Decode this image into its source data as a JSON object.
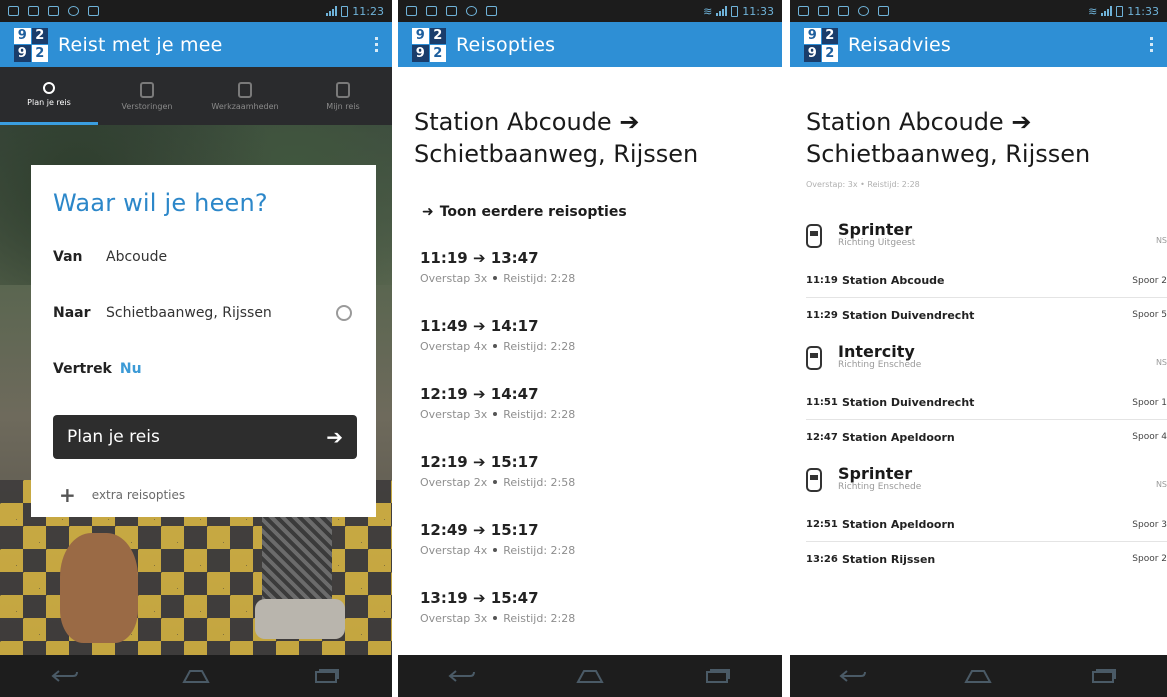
{
  "statusbar": {
    "s1_time": "11:23",
    "s2_time": "11:33",
    "s3_time": "11:33"
  },
  "screen1": {
    "app_title": "Reist met je mee",
    "tabs": [
      {
        "label": "Plan je reis"
      },
      {
        "label": "Verstoringen"
      },
      {
        "label": "Werkzaamheden"
      },
      {
        "label": "Mijn reis"
      }
    ],
    "card_title": "Waar wil je heen?",
    "van_label": "Van",
    "van_value": "Abcoude",
    "naar_label": "Naar",
    "naar_value": "Schietbaanweg, Rijssen",
    "vertrek_label": "Vertrek",
    "vertrek_value": "Nu",
    "plan_button": "Plan je reis",
    "extra_options": "extra reisopties"
  },
  "screen2": {
    "app_title": "Reisopties",
    "route_line1": "Station Abcoude ➔",
    "route_line2": "Schietbaanweg, Rijssen",
    "earlier_options": "Toon eerdere reisopties",
    "options": [
      {
        "time": "11:19 ➔ 13:47",
        "transfer": "Overstap 3x",
        "duration": "Reistijd: 2:28"
      },
      {
        "time": "11:49 ➔ 14:17",
        "transfer": "Overstap 4x",
        "duration": "Reistijd: 2:28"
      },
      {
        "time": "12:19 ➔ 14:47",
        "transfer": "Overstap 3x",
        "duration": "Reistijd: 2:28"
      },
      {
        "time": "12:19 ➔ 15:17",
        "transfer": "Overstap 2x",
        "duration": "Reistijd: 2:58"
      },
      {
        "time": "12:49 ➔ 15:17",
        "transfer": "Overstap 4x",
        "duration": "Reistijd: 2:28"
      },
      {
        "time": "13:19 ➔ 15:47",
        "transfer": "Overstap 3x",
        "duration": "Reistijd: 2:28"
      }
    ]
  },
  "screen3": {
    "app_title": "Reisadvies",
    "route_line1": "Station Abcoude ➔",
    "route_line2": "Schietbaanweg, Rijssen",
    "subinfo": "Overstap: 3x • Reistijd: 2:28",
    "legs": [
      {
        "train": "Sprinter",
        "direction": "Richting Uitgeest",
        "operator": "NS",
        "stops": [
          {
            "time": "11:19",
            "station": "Station Abcoude",
            "track": "Spoor 2"
          },
          {
            "time": "11:29",
            "station": "Station Duivendrecht",
            "track": "Spoor 5"
          }
        ]
      },
      {
        "train": "Intercity",
        "direction": "Richting Enschede",
        "operator": "NS",
        "stops": [
          {
            "time": "11:51",
            "station": "Station Duivendrecht",
            "track": "Spoor 1"
          },
          {
            "time": "12:47",
            "station": "Station Apeldoorn",
            "track": "Spoor 4"
          }
        ]
      },
      {
        "train": "Sprinter",
        "direction": "Richting Enschede",
        "operator": "NS",
        "stops": [
          {
            "time": "12:51",
            "station": "Station Apeldoorn",
            "track": "Spoor 3"
          },
          {
            "time": "13:26",
            "station": "Station Rijssen",
            "track": "Spoor 2"
          }
        ]
      }
    ]
  },
  "logo": [
    "9",
    "2",
    "9",
    "2"
  ]
}
